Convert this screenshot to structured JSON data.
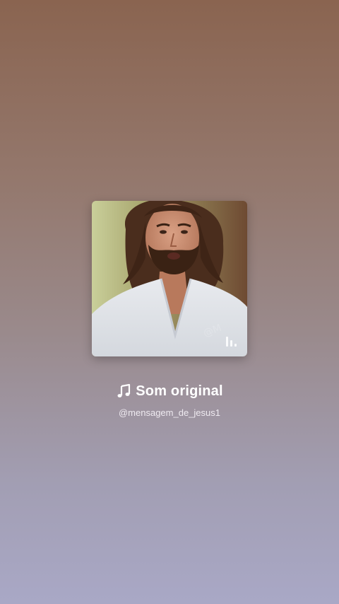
{
  "audio": {
    "title": "Som original",
    "handle": "@mensagem_de_jesus1",
    "title_icon": "music-note-icon",
    "cover_badge_icon": "audio-bars-icon"
  },
  "colors": {
    "background_top": "#8a6450",
    "background_bottom": "#a9a8c6",
    "text_primary": "#ffffff",
    "text_secondary": "#eeeaf0"
  }
}
